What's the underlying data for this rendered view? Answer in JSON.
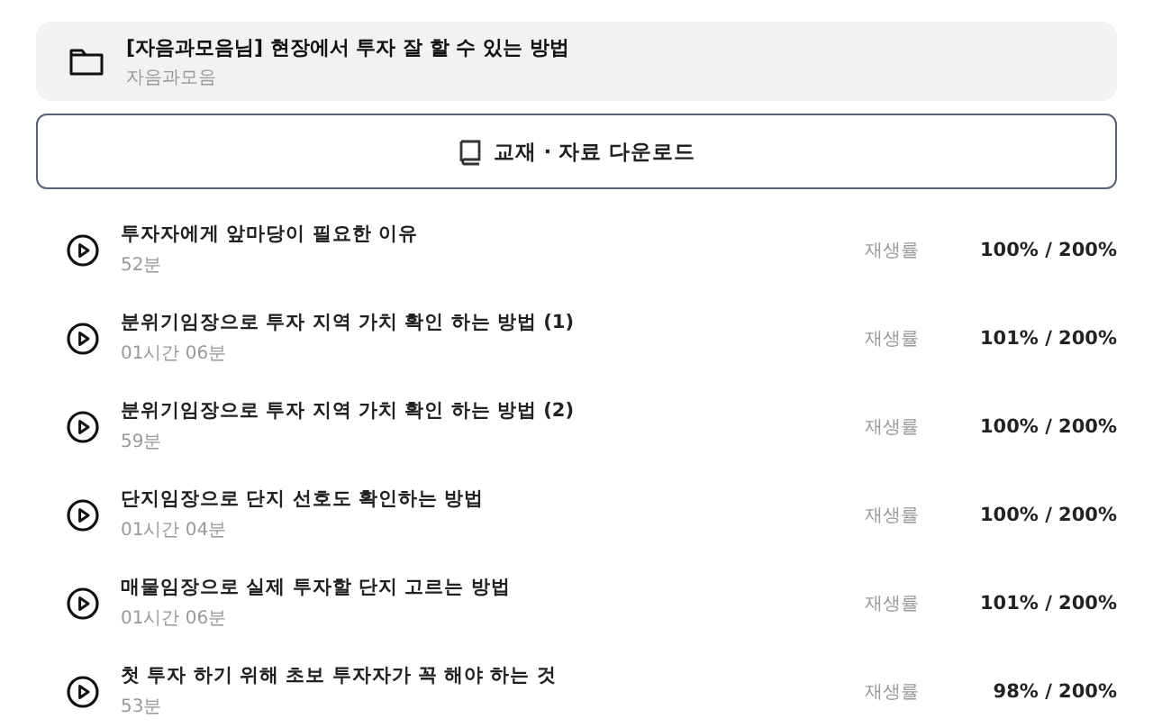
{
  "course": {
    "title": "[자음과모음님] 현장에서 투자 잘 할 수 있는 방법",
    "author": "자음과모음"
  },
  "download_button": {
    "label": "교재 · 자료 다운로드"
  },
  "lessons": [
    {
      "title": "투자자에게 앞마당이 필요한 이유",
      "duration": "52분",
      "rate_label": "재생률",
      "rate": "100% / 200%"
    },
    {
      "title": "분위기임장으로 투자 지역 가치 확인 하는 방법 (1)",
      "duration": "01시간 06분",
      "rate_label": "재생률",
      "rate": "101% / 200%"
    },
    {
      "title": "분위기임장으로 투자 지역 가치 확인 하는 방법 (2)",
      "duration": "59분",
      "rate_label": "재생률",
      "rate": "100% / 200%"
    },
    {
      "title": "단지임장으로 단지 선호도 확인하는 방법",
      "duration": "01시간 04분",
      "rate_label": "재생률",
      "rate": "100% / 200%"
    },
    {
      "title": "매물임장으로 실제 투자할 단지 고르는 방법",
      "duration": "01시간 06분",
      "rate_label": "재생률",
      "rate": "101% / 200%"
    },
    {
      "title": "첫 투자 하기 위해 초보 투자자가 꼭 해야 하는 것",
      "duration": "53분",
      "rate_label": "재생률",
      "rate": "98% / 200%"
    }
  ]
}
